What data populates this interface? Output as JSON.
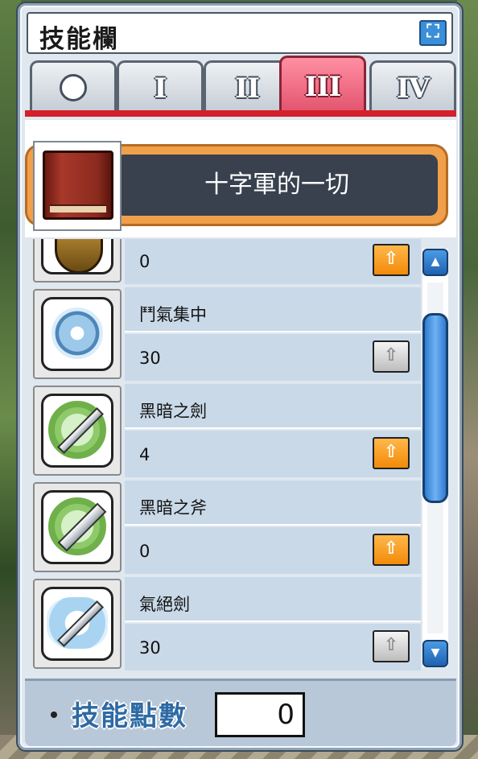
{
  "window": {
    "title": "技能欄",
    "close_symbol": "⛶"
  },
  "tabs": [
    {
      "label": "",
      "icon": "dot-icon",
      "active": false
    },
    {
      "label": "I",
      "active": false
    },
    {
      "label": "II",
      "active": false
    },
    {
      "label": "III",
      "active": true
    },
    {
      "label": "IV",
      "active": false
    }
  ],
  "job": {
    "name": "十字軍的一切",
    "icon": "skill-book-icon"
  },
  "skills": [
    {
      "name": "",
      "level": "0",
      "icon": "shield-emblem-icon",
      "upgradable": true
    },
    {
      "name": "鬥氣集中",
      "level": "30",
      "icon": "combo-orbs-icon",
      "upgradable": false
    },
    {
      "name": "黑暗之劍",
      "level": "4",
      "icon": "dark-sword-icon",
      "upgradable": true
    },
    {
      "name": "黑暗之斧",
      "level": "0",
      "icon": "dark-axe-icon",
      "upgradable": true
    },
    {
      "name": "氣絕劍",
      "level": "30",
      "icon": "stun-sword-icon",
      "upgradable": false
    }
  ],
  "up_symbol": "⇧",
  "scrollbar": {
    "up_symbol": "▲",
    "down_symbol": "▼"
  },
  "footer": {
    "label": "技能點數",
    "points": "0"
  },
  "colors": {
    "accent_red": "#d4202a",
    "tab_active": "#e2546e",
    "job_band": "#f0a04a",
    "upgrade_orange": "#f28a0a",
    "scroll_blue": "#2f7bd0"
  }
}
